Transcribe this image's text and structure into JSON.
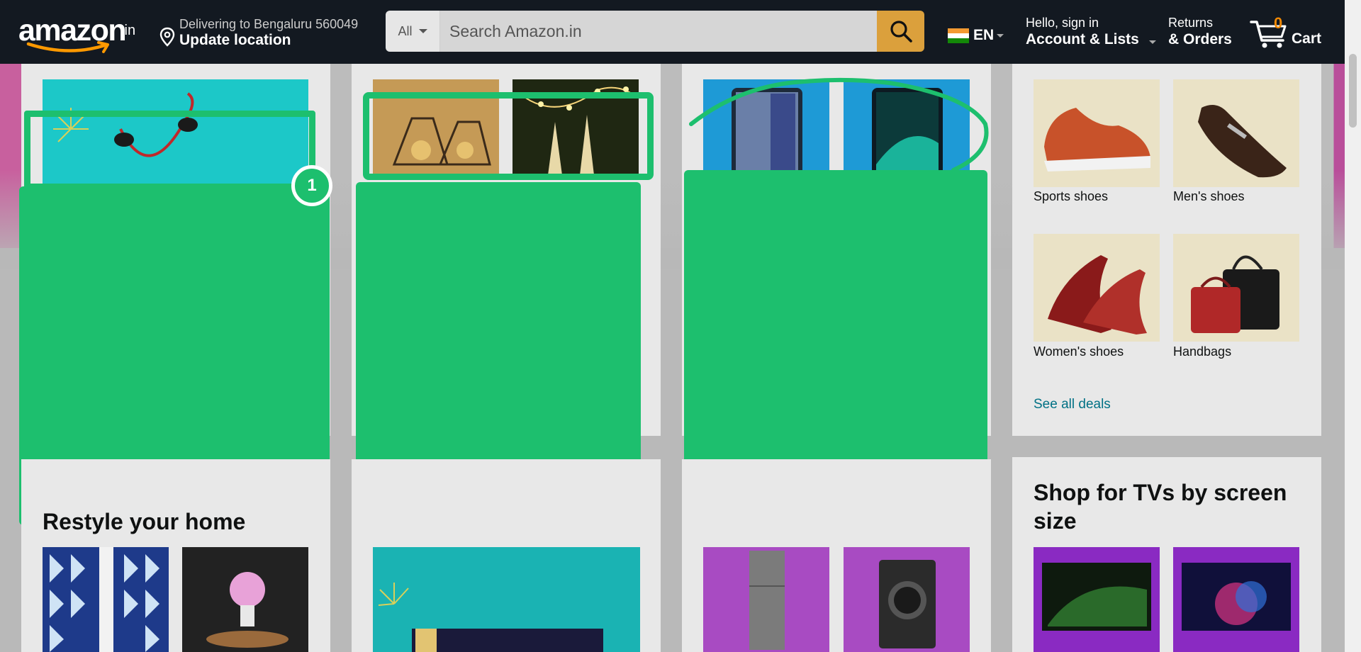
{
  "header": {
    "logo_text": "amazon",
    "logo_suffix": ".in",
    "location_line1": "Delivering to Bengaluru 560049",
    "location_line2": "Update location",
    "search_category": "All",
    "search_placeholder": "Search Amazon.in",
    "language": "EN",
    "account_line1": "Hello, sign in",
    "account_line2": "Account & Lists",
    "returns_line1": "Returns",
    "returns_line2": "& Orders",
    "cart_count": "0",
    "cart_label": "Cart"
  },
  "cards": {
    "restyle_title": "Restyle your home",
    "shoes": {
      "tiles": [
        {
          "caption": "Sports shoes"
        },
        {
          "caption": "Men's shoes"
        },
        {
          "caption": "Women's shoes"
        },
        {
          "caption": "Handbags"
        }
      ],
      "see_all": "See all deals"
    },
    "tv_title": "Shop for TVs by screen size"
  },
  "annotation": {
    "badge_number": "1"
  },
  "colors": {
    "nav_bg": "#131921",
    "search_button": "#dba03c",
    "overlay_green": "#1dbf6e",
    "link": "#007185"
  }
}
